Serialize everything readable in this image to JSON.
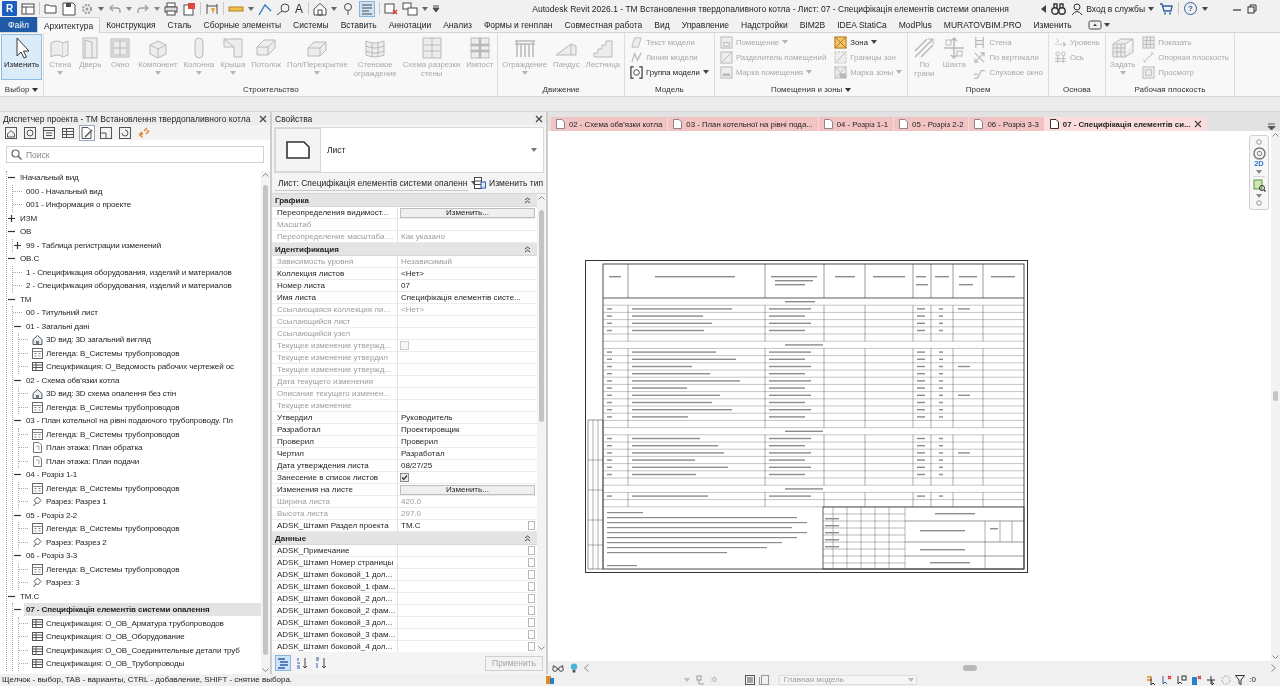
{
  "title_bar": {
    "logo": "R",
    "text_tool_glyph": "A",
    "thin_lines_on": true,
    "title": "Autodesk Revit 2026.1 - ТМ Встановлення твердопаливного котла - Лист: 07 - Специфікація елементів системи опалення",
    "sign_in": "Вход в службы",
    "help": "?"
  },
  "ribbon_tabs": [
    {
      "label": "Файл",
      "kind": "file",
      "selected": false
    },
    {
      "label": "Архитектура",
      "kind": "tab",
      "selected": true
    },
    {
      "label": "Конструкция",
      "kind": "tab",
      "selected": false
    },
    {
      "label": "Сталь",
      "kind": "tab",
      "selected": false
    },
    {
      "label": "Сборные элементы",
      "kind": "tab",
      "selected": false
    },
    {
      "label": "Системы",
      "kind": "tab",
      "selected": false
    },
    {
      "label": "Вставить",
      "kind": "tab",
      "selected": false
    },
    {
      "label": "Аннотации",
      "kind": "tab",
      "selected": false
    },
    {
      "label": "Анализ",
      "kind": "tab",
      "selected": false
    },
    {
      "label": "Формы и генплан",
      "kind": "tab",
      "selected": false
    },
    {
      "label": "Совместная работа",
      "kind": "tab",
      "selected": false
    },
    {
      "label": "Вид",
      "kind": "tab",
      "selected": false
    },
    {
      "label": "Управление",
      "kind": "tab",
      "selected": false
    },
    {
      "label": "Надстройки",
      "kind": "tab",
      "selected": false
    },
    {
      "label": "BIM2B",
      "kind": "tab",
      "selected": false
    },
    {
      "label": "IDEA StatiCa",
      "kind": "tab",
      "selected": false
    },
    {
      "label": "ModPlus",
      "kind": "tab",
      "selected": false
    },
    {
      "label": "MURATOVBIM.PRO",
      "kind": "tab",
      "selected": false
    },
    {
      "label": "Изменить",
      "kind": "tab",
      "selected": false
    }
  ],
  "ribbon_panels": [
    {
      "title": "Выбор",
      "menu": true,
      "items": [
        {
          "kind": "large",
          "label": "Изменить",
          "disabled": false,
          "selected": true,
          "menu": false
        }
      ]
    },
    {
      "title": "Строительство",
      "menu": false,
      "items": [
        {
          "kind": "large",
          "label": "Стена",
          "disabled": true,
          "selected": false,
          "menu": true
        },
        {
          "kind": "large",
          "label": "Дверь",
          "disabled": true,
          "selected": false,
          "menu": false
        },
        {
          "kind": "large",
          "label": "Окно",
          "disabled": true,
          "selected": false,
          "menu": false
        },
        {
          "kind": "large",
          "label": "Компонент",
          "disabled": true,
          "selected": false,
          "menu": true
        },
        {
          "kind": "large",
          "label": "Колонна",
          "disabled": true,
          "selected": false,
          "menu": true
        },
        {
          "kind": "large",
          "label": "Крыша",
          "disabled": true,
          "selected": false,
          "menu": true
        },
        {
          "kind": "large",
          "label": "Потолок",
          "disabled": true,
          "selected": false,
          "menu": false
        },
        {
          "kind": "large",
          "label": "Пол/Перекрытие",
          "disabled": true,
          "selected": false,
          "menu": true
        },
        {
          "kind": "large",
          "label": "Стеновое\nограждение",
          "disabled": true,
          "selected": false,
          "menu": false
        },
        {
          "kind": "large",
          "label": "Схема разрезки\nстены",
          "disabled": true,
          "selected": false,
          "menu": false
        },
        {
          "kind": "large",
          "label": "Импост",
          "disabled": true,
          "selected": false,
          "menu": false
        }
      ]
    },
    {
      "title": "Движение",
      "menu": false,
      "items": [
        {
          "kind": "large",
          "label": "Ограждение",
          "disabled": true,
          "selected": false,
          "menu": true
        },
        {
          "kind": "large",
          "label": "Пандус",
          "disabled": true,
          "selected": false,
          "menu": false
        },
        {
          "kind": "large",
          "label": "Лестница",
          "disabled": true,
          "selected": false,
          "menu": false
        }
      ]
    },
    {
      "title": "Модель",
      "menu": false,
      "items": [
        {
          "kind": "stack",
          "buttons": [
            {
              "label": "Текст модели",
              "disabled": true,
              "menu": false
            },
            {
              "label": "Линия модели",
              "disabled": true,
              "menu": false
            },
            {
              "label": "Группа модели",
              "disabled": false,
              "menu": true
            }
          ]
        }
      ]
    },
    {
      "title": "Помещения и зоны",
      "menu": true,
      "items": [
        {
          "kind": "stack",
          "buttons": [
            {
              "label": "Помещение",
              "disabled": true,
              "menu": true
            },
            {
              "label": "Разделитель помещений",
              "disabled": true,
              "menu": false
            },
            {
              "label": "Марка помещения",
              "disabled": true,
              "menu": true
            }
          ]
        },
        {
          "kind": "stack",
          "buttons": [
            {
              "label": "Зона",
              "disabled": false,
              "menu": true
            },
            {
              "label": "Границы зон",
              "disabled": true,
              "menu": false
            },
            {
              "label": "Марка зоны",
              "disabled": true,
              "menu": true
            }
          ]
        }
      ]
    },
    {
      "title": "Проем",
      "menu": false,
      "items": [
        {
          "kind": "large",
          "label": "По\nграни",
          "disabled": true,
          "selected": false,
          "menu": false
        },
        {
          "kind": "large",
          "label": "Шахта",
          "disabled": true,
          "selected": false,
          "menu": false
        },
        {
          "kind": "stack",
          "buttons": [
            {
              "label": "Стена",
              "disabled": true,
              "menu": false
            },
            {
              "label": "По вертикали",
              "disabled": true,
              "menu": false
            },
            {
              "label": "Слуховое окно",
              "disabled": true,
              "menu": false
            }
          ]
        }
      ]
    },
    {
      "title": "Основа",
      "menu": false,
      "items": [
        {
          "kind": "stack",
          "buttons": [
            {
              "label": "Уровень",
              "disabled": true,
              "menu": false
            },
            {
              "label": "Ось",
              "disabled": true,
              "menu": false
            }
          ]
        }
      ]
    },
    {
      "title": "Рабочая плоскость",
      "menu": false,
      "items": [
        {
          "kind": "large",
          "label": "Задать",
          "disabled": true,
          "selected": false,
          "menu": true
        },
        {
          "kind": "stack",
          "buttons": [
            {
              "label": "Показать",
              "disabled": true,
              "menu": false
            },
            {
              "label": "Опорная плоскость",
              "disabled": true,
              "menu": false
            },
            {
              "label": "Просмотр",
              "disabled": true,
              "menu": false
            }
          ]
        }
      ]
    }
  ],
  "project_browser": {
    "title": "Диспетчер проекта - ТМ Встановлення твердопаливного котла",
    "toolbar": [
      {
        "selected": false
      },
      {
        "selected": false
      },
      {
        "selected": false
      },
      {
        "selected": false
      },
      {
        "selected": true
      },
      {
        "selected": false
      },
      {
        "selected": false
      },
      {
        "selected": false
      }
    ],
    "search": {
      "placeholder": "Поиск"
    },
    "tree": [
      {
        "label": "!Начальный вид",
        "expanded": true,
        "selected": false,
        "children": [
          {
            "label": "000 - Начальный вид",
            "selected": false
          },
          {
            "label": "001 - Информация о проекте",
            "selected": false
          }
        ]
      },
      {
        "label": "ИЗМ",
        "expanded": false,
        "selected": false
      },
      {
        "label": "ОВ",
        "expanded": true,
        "selected": false,
        "children": [
          {
            "label": "99 - Таблица регистрации изменений",
            "expanded": false,
            "selected": false
          }
        ]
      },
      {
        "label": "ОВ.С",
        "expanded": true,
        "selected": false,
        "children": [
          {
            "label": "1 - Спецификация оборудования, изделий и материалов",
            "selected": false
          },
          {
            "label": "2 - Спецификация оборудования, изделий и материалов",
            "selected": false
          }
        ]
      },
      {
        "label": "ТМ",
        "expanded": true,
        "selected": false,
        "children": [
          {
            "label": "00 - Титульний лист",
            "selected": false
          },
          {
            "label": "01 - Загальні дані",
            "expanded": true,
            "selected": false,
            "children": [
              {
                "label": "3D вид: 3D загальний вигляд",
                "kind": "view3d",
                "selected": false
              },
              {
                "label": "Легенда: В_Системы трубопроводов",
                "kind": "legend",
                "selected": false
              },
              {
                "label": "Спецификация: О_Ведомость рабочих чертежей ос",
                "kind": "schedule",
                "selected": false
              }
            ]
          },
          {
            "label": "02 - Схема обв'язки котла",
            "expanded": true,
            "selected": false,
            "children": [
              {
                "label": "3D вид: 3D схема опалення без стін",
                "kind": "view3d",
                "selected": false
              },
              {
                "label": "Легенда: В_Системы трубопроводов",
                "kind": "legend",
                "selected": false
              }
            ]
          },
          {
            "label": "03 - План котельної на рівні подаючого трубопроводу. Пл",
            "expanded": true,
            "selected": false,
            "children": [
              {
                "label": "Легенда: В_Системы трубопроводов",
                "kind": "legend",
                "selected": false
              },
              {
                "label": "План этажа: План обратка",
                "kind": "plan",
                "selected": false
              },
              {
                "label": "План этажа: План подачи",
                "kind": "plan",
                "selected": false
              }
            ]
          },
          {
            "label": "04 - Розріз 1-1",
            "expanded": true,
            "selected": false,
            "children": [
              {
                "label": "Легенда: В_Системы трубопроводов",
                "kind": "legend",
                "selected": false
              },
              {
                "label": "Разрез: Разрез 1",
                "kind": "section",
                "selected": false
              }
            ]
          },
          {
            "label": "05 - Розріз 2-2",
            "expanded": true,
            "selected": false,
            "children": [
              {
                "label": "Легенда: В_Системы трубопроводов",
                "kind": "legend",
                "selected": false
              },
              {
                "label": "Разрез: Разрез 2",
                "kind": "section",
                "selected": false
              }
            ]
          },
          {
            "label": "06 - Розріз 3-3",
            "expanded": true,
            "selected": false,
            "children": [
              {
                "label": "Легенда: В_Системы трубопроводов",
                "kind": "legend",
                "selected": false
              },
              {
                "label": "Разрез: 3",
                "kind": "section",
                "selected": false
              }
            ]
          }
        ]
      },
      {
        "label": "ТМ.С",
        "expanded": true,
        "selected": false,
        "children": [
          {
            "label": "07 - Специфікація елементів системи опалення",
            "expanded": true,
            "selected": true,
            "children": [
              {
                "label": "Спецификация: О_ОВ_Арматура трубопроводов",
                "kind": "schedule",
                "selected": false
              },
              {
                "label": "Спецификация: О_ОВ_Оборудование",
                "kind": "schedule",
                "selected": false
              },
              {
                "label": "Спецификация: О_ОВ_Соединительные детали труб",
                "kind": "schedule",
                "selected": false
              },
              {
                "label": "Спецификация: О_ОВ_Трубопроводы",
                "kind": "schedule",
                "selected": false
              }
            ]
          }
        ]
      }
    ]
  },
  "properties": {
    "title": "Свойства",
    "type_name": "Лист",
    "instance_filter": "Лист: Специфікація елементів системи опаленн",
    "edit_type": "Изменить тип",
    "groups": [
      {
        "name": "Графика",
        "expanded": true,
        "rows": [
          {
            "label": "Переопределения видимост...",
            "kind": "button",
            "value": "Изменить...",
            "disabled": false
          },
          {
            "label": "Масштаб",
            "kind": "text",
            "disabled": true
          },
          {
            "label": "Переопределение масштаба ...",
            "kind": "text",
            "value": "Как указано",
            "disabled": true
          }
        ]
      },
      {
        "name": "Идентификация",
        "expanded": true,
        "rows": [
          {
            "label": "Зависимость уровня",
            "kind": "text",
            "value": "Независимый",
            "disabled": true
          },
          {
            "label": "Коллекция листов",
            "kind": "text",
            "value": "<Нет>",
            "disabled": false
          },
          {
            "label": "Номер листа",
            "kind": "text",
            "value": "07",
            "disabled": false
          },
          {
            "label": "Имя листа",
            "kind": "text",
            "value": "Специфікація елементів систе...",
            "disabled": false
          },
          {
            "label": "Ссылающаяся коллекция ли...",
            "kind": "text",
            "value": "<Нет>",
            "disabled": true
          },
          {
            "label": "Ссылающийся лист",
            "kind": "text",
            "disabled": true
          },
          {
            "label": "Ссылающийся узел",
            "kind": "text",
            "disabled": true
          },
          {
            "label": "Текущее изменение утвержд...",
            "kind": "checkbox",
            "checked": false,
            "disabled": true
          },
          {
            "label": "Текущее изменение утвердил",
            "kind": "text",
            "disabled": true
          },
          {
            "label": "Текущее изменение утвержд...",
            "kind": "text",
            "disabled": true
          },
          {
            "label": "Дата текущего изменения",
            "kind": "text",
            "disabled": true
          },
          {
            "label": "Описание текущего изменен...",
            "kind": "text",
            "disabled": true
          },
          {
            "label": "Текущее изменение",
            "kind": "text",
            "disabled": true
          },
          {
            "label": "Утвердил",
            "kind": "text",
            "value": "Руководитель",
            "disabled": false
          },
          {
            "label": "Разработал",
            "kind": "text",
            "value": "Проектировщик",
            "disabled": false
          },
          {
            "label": "Проверил",
            "kind": "text",
            "value": "Проверил",
            "disabled": false
          },
          {
            "label": "Чертил",
            "kind": "text",
            "value": "Разработал",
            "disabled": false
          },
          {
            "label": "Дата утверждения листа",
            "kind": "text",
            "value": "08/27/25",
            "disabled": false
          },
          {
            "label": "Занесение в список листов",
            "kind": "checkbox",
            "checked": true,
            "disabled": false
          },
          {
            "label": "Изменения на листе",
            "kind": "button",
            "value": "Изменить...",
            "disabled": false
          },
          {
            "label": "Ширина листа",
            "kind": "text",
            "value": "420.0",
            "disabled": true
          },
          {
            "label": "Высота листа",
            "kind": "text",
            "value": "297.0",
            "disabled": true
          },
          {
            "label": "ADSK_Штамп Раздел проекта",
            "kind": "param",
            "value": "ТМ.С",
            "disabled": false
          }
        ]
      },
      {
        "name": "Данные",
        "expanded": true,
        "rows": [
          {
            "label": "ADSK_Примечание",
            "kind": "param",
            "disabled": false
          },
          {
            "label": "ADSK_Штамп Номер страницы",
            "kind": "param",
            "disabled": false
          },
          {
            "label": "ADSK_Штамп боковой_1 дол...",
            "kind": "param",
            "disabled": false
          },
          {
            "label": "ADSK_Штамп боковой_1 фам...",
            "kind": "param",
            "disabled": false
          },
          {
            "label": "ADSK_Штамп боковой_2 дол...",
            "kind": "param",
            "disabled": false
          },
          {
            "label": "ADSK_Штамп боковой_2 фам...",
            "kind": "param",
            "disabled": false
          },
          {
            "label": "ADSK_Штамп боковой_3 дол...",
            "kind": "param",
            "disabled": false
          },
          {
            "label": "ADSK_Штамп боковой_3 фам...",
            "kind": "param",
            "disabled": false
          },
          {
            "label": "ADSK_Штамп боковой_4 дол...",
            "kind": "param",
            "disabled": false
          }
        ]
      }
    ],
    "view_modes": [
      {
        "kind": "categorized",
        "selected": true
      },
      {
        "kind": "ascending",
        "selected": false
      },
      {
        "kind": "descending",
        "selected": false
      }
    ],
    "apply": {
      "label": "Применить",
      "disabled": true
    }
  },
  "view_tabs": [
    {
      "label": "02 - Схема обв'язки котла",
      "selected": false
    },
    {
      "label": "03 - План котельної на рівні пода...",
      "selected": false
    },
    {
      "label": "04 - Розріз 1-1",
      "selected": false
    },
    {
      "label": "05 - Розріз 2-2",
      "selected": false
    },
    {
      "label": "06 - Розріз 3-3",
      "selected": false
    },
    {
      "label": "07 - Специфікація елементів си...",
      "selected": true
    }
  ],
  "nav_bar": {
    "wheel_label": "2D"
  },
  "status_bar": {
    "hint": "Щелчок - выбор, TAB - варианты, CTRL - добавление, SHIFT - снятие выбора.",
    "indicator_count": ":0",
    "model": {
      "value": "Главная модель",
      "disabled": true
    },
    "filter_count": ":0"
  }
}
